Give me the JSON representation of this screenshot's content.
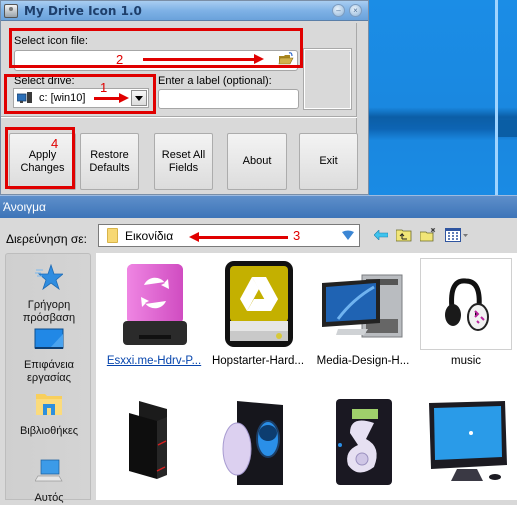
{
  "desktop": {
    "wallpaper": "Windows 10 default"
  },
  "app": {
    "title": "My Drive Icon 1.0",
    "icon": "drive-icon",
    "window_buttons": [
      {
        "name": "minimize",
        "glyph": "–"
      },
      {
        "name": "close",
        "glyph": "×"
      }
    ],
    "icon_file": {
      "label": "Select icon file:",
      "value": "",
      "browse_icon": "open-folder-icon"
    },
    "drive": {
      "label": "Select drive:",
      "value": "c: [win10]",
      "icon": "computer-icon"
    },
    "drive_label": {
      "label": "Enter a label (optional):",
      "value": ""
    },
    "buttons": [
      {
        "id": "apply",
        "label": "Apply\nChanges"
      },
      {
        "id": "restore",
        "label": "Restore\nDefaults"
      },
      {
        "id": "reset",
        "label": "Reset All\nFields"
      },
      {
        "id": "about",
        "label": "About"
      },
      {
        "id": "exit",
        "label": "Exit"
      }
    ]
  },
  "annotations": [
    {
      "number": "1",
      "target": "drive-select"
    },
    {
      "number": "2",
      "target": "icon-file-field"
    },
    {
      "number": "3",
      "target": "look-in-select"
    },
    {
      "number": "4",
      "target": "apply-changes-button"
    }
  ],
  "annotation_color": "#e00000",
  "open_dialog": {
    "title": "Άνοιγμα",
    "look_in_label": "Διερεύνηση σε:",
    "look_in_value": "Εικονίδια",
    "toolbar": [
      "back-icon",
      "up-folder-icon",
      "new-folder-icon",
      "view-menu-icon"
    ],
    "places": [
      {
        "label": "Γρήγορη\nπρόσβαση",
        "icon": "star-icon"
      },
      {
        "label": "Επιφάνεια\nεργασίας",
        "icon": "desktop-icon"
      },
      {
        "label": "Βιβλιοθήκες",
        "icon": "libraries-icon"
      },
      {
        "label": "Αυτός",
        "icon": "this-pc-icon"
      }
    ],
    "files": [
      {
        "name": "Esxxi.me-Hdrv-P...",
        "icon": "pink-drive-icon",
        "state": "link"
      },
      {
        "name": "Hopstarter-Hard...",
        "icon": "google-drive-disk-icon",
        "state": ""
      },
      {
        "name": "Media-Design-H...",
        "icon": "computer-monitor-tower-icon",
        "state": ""
      },
      {
        "name": "music",
        "icon": "headphones-icon",
        "state": "selected"
      },
      {
        "name": "",
        "icon": "black-server-icon",
        "state": ""
      },
      {
        "name": "",
        "icon": "dvd-drive-icon",
        "state": ""
      },
      {
        "name": "",
        "icon": "hard-disk-icon",
        "state": ""
      },
      {
        "name": "",
        "icon": "imac-monitor-icon",
        "state": ""
      }
    ]
  }
}
